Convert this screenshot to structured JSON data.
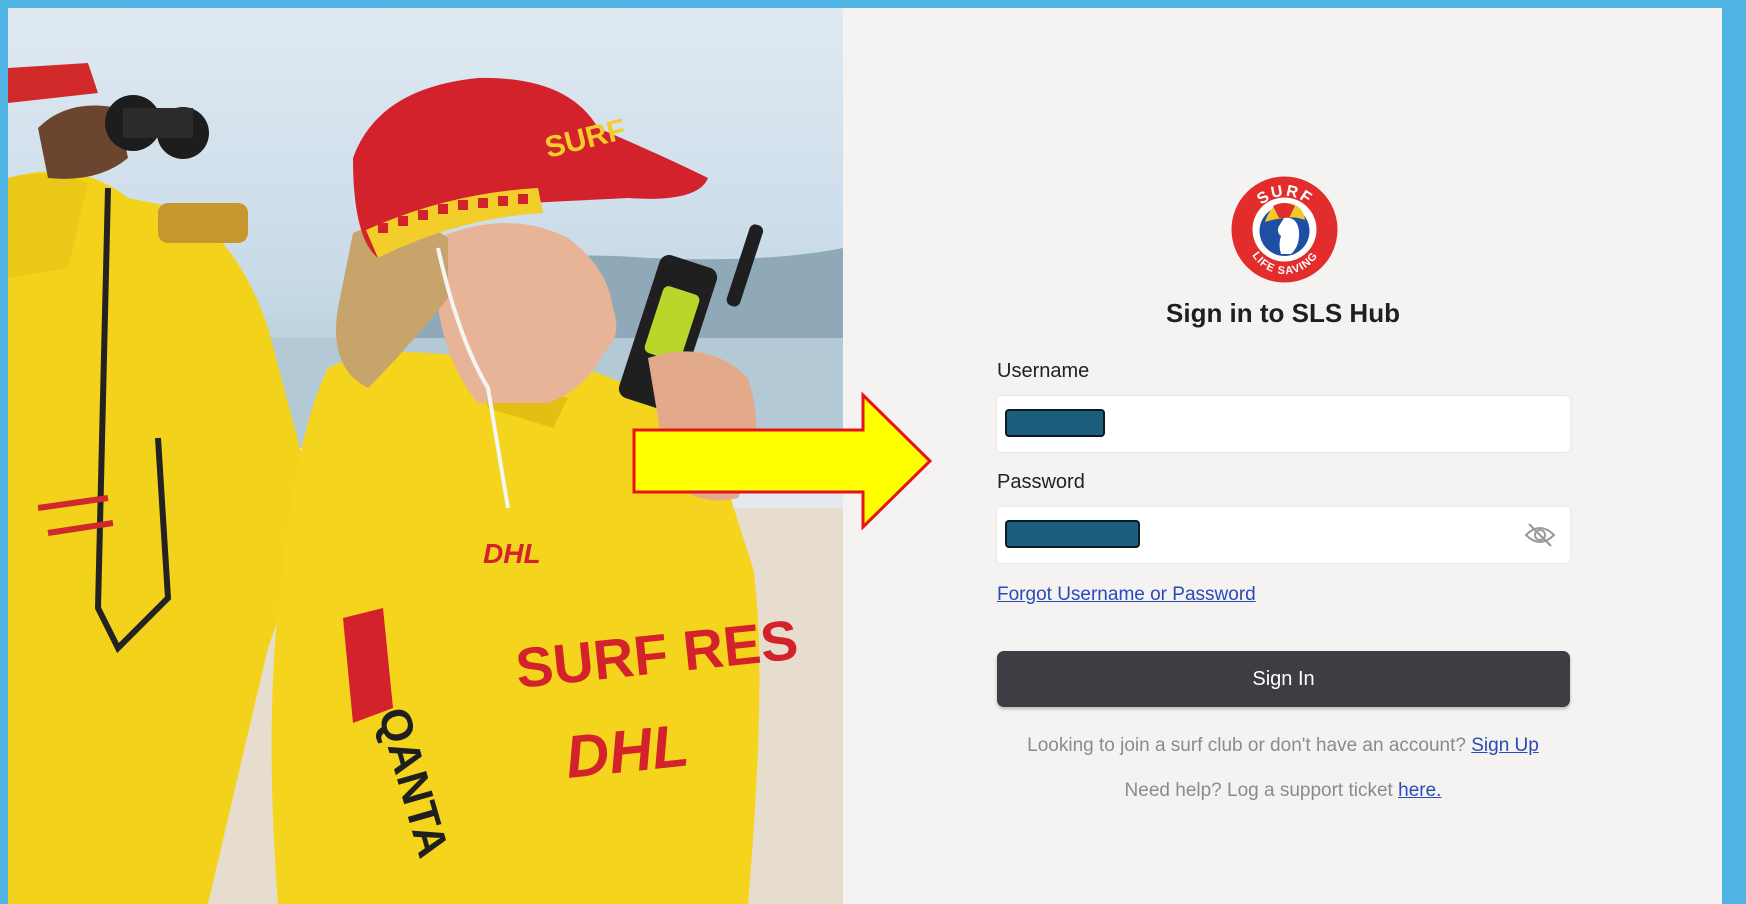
{
  "login": {
    "title": "Sign in to SLS Hub",
    "username_label": "Username",
    "password_label": "Password",
    "forgot_link": "Forgot Username or Password",
    "sign_in_button": "Sign In",
    "join_prompt": "Looking to join a surf club or don't have an account?",
    "sign_up_link": "Sign Up",
    "help_prompt": "Need help? Log a support ticket",
    "help_link": "here."
  },
  "logo": {
    "top_text": "SURF",
    "bottom_text": "LIFE SAVING"
  },
  "photo": {
    "cap_text": "SURF",
    "sponsor_text": "DHL",
    "shirt_text": "SURF RES",
    "sleeve_text": "QANTA"
  },
  "colors": {
    "frame": "#4fb3e3",
    "panel_bg": "#f4f3f1",
    "button_bg": "#3d3e44",
    "link": "#2a4bb6",
    "redaction": "#1b5e7e",
    "arrow_fill": "#ffff00",
    "arrow_stroke": "#e8121b"
  },
  "icons": {
    "password_toggle": "eye-slash-icon"
  }
}
